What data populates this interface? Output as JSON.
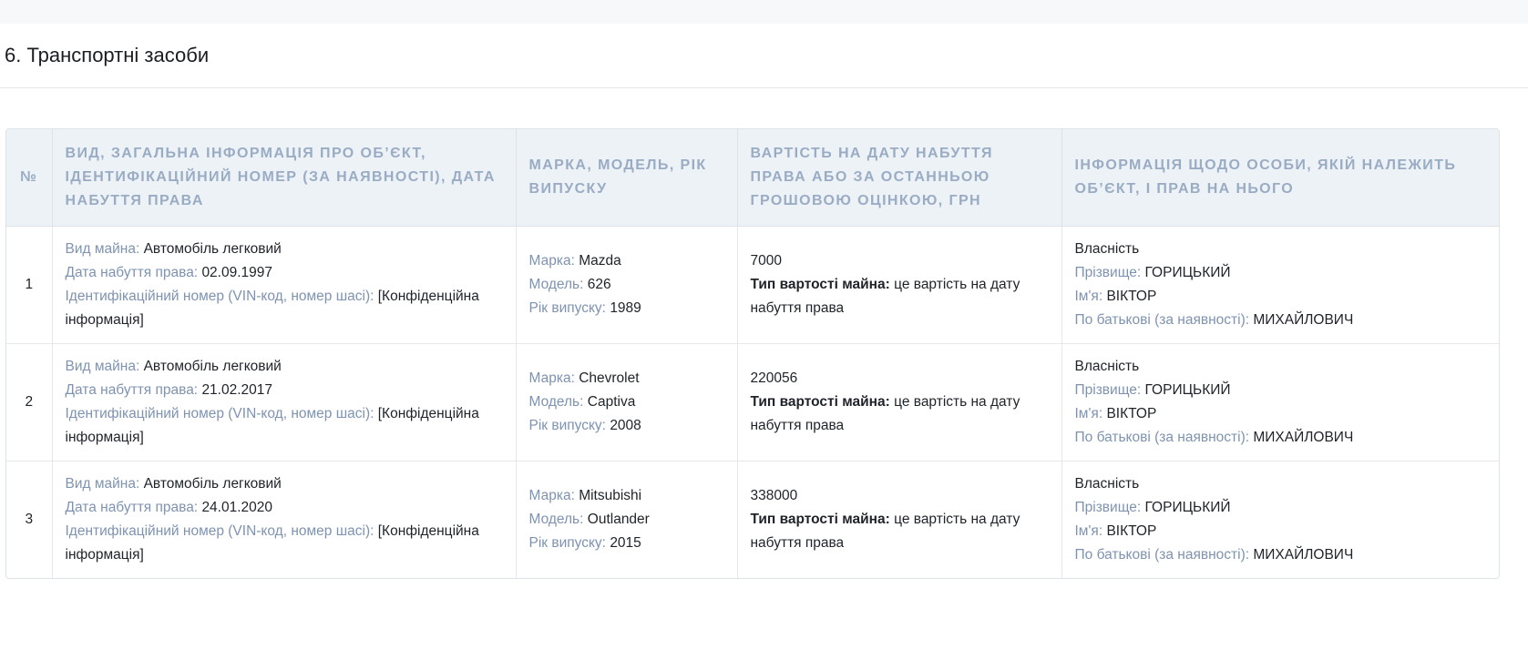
{
  "section_title": "6. Транспортні засоби",
  "table": {
    "headers": [
      "№",
      "Вид, загальна інформація про об’єкт, ідентифікаційний номер (за наявності), дата набуття права",
      "Марка, модель, рік випуску",
      "Вартість на дату набуття права або за останньою грошовою оцінкою, грн",
      "Інформація щодо особи, якій належить об’єкт, і прав на нього"
    ],
    "labels": {
      "kind": "Вид майна:",
      "date": "Дата набуття права:",
      "vin": "Ідентифікаційний номер (VIN-код, номер шасі):",
      "brand": "Марка:",
      "model": "Модель:",
      "year": "Рік випуску:",
      "value_type": "Тип вартості майна:",
      "surname": "Прізвище:",
      "name": "Ім'я:",
      "patronymic": "По батькові (за наявності):"
    },
    "rows": [
      {
        "num": "1",
        "kind": "Автомобіль легковий",
        "date": "02.09.1997",
        "vin": "[Конфіденційна інформація]",
        "brand": "Mazda",
        "model": "626",
        "year": "1989",
        "value": "7000",
        "value_type": "це вартість на дату набуття права",
        "right": "Власність",
        "surname": "ГОРИЦЬКИЙ",
        "name": "ВІКТОР",
        "patronymic": "МИХАЙЛОВИЧ"
      },
      {
        "num": "2",
        "kind": "Автомобіль легковий",
        "date": "21.02.2017",
        "vin": "[Конфіденційна інформація]",
        "brand": "Chevrolet",
        "model": "Captiva",
        "year": "2008",
        "value": "220056",
        "value_type": "це вартість на дату набуття права",
        "right": "Власність",
        "surname": "ГОРИЦЬКИЙ",
        "name": "ВІКТОР",
        "patronymic": "МИХАЙЛОВИЧ"
      },
      {
        "num": "3",
        "kind": "Автомобіль легковий",
        "date": "24.01.2020",
        "vin": "[Конфіденційна інформація]",
        "brand": "Mitsubishi",
        "model": "Outlander",
        "year": "2015",
        "value": "338000",
        "value_type": "це вартість на дату набуття права",
        "right": "Власність",
        "surname": "ГОРИЦЬКИЙ",
        "name": "ВІКТОР",
        "patronymic": "МИХАЙЛОВИЧ"
      }
    ]
  }
}
